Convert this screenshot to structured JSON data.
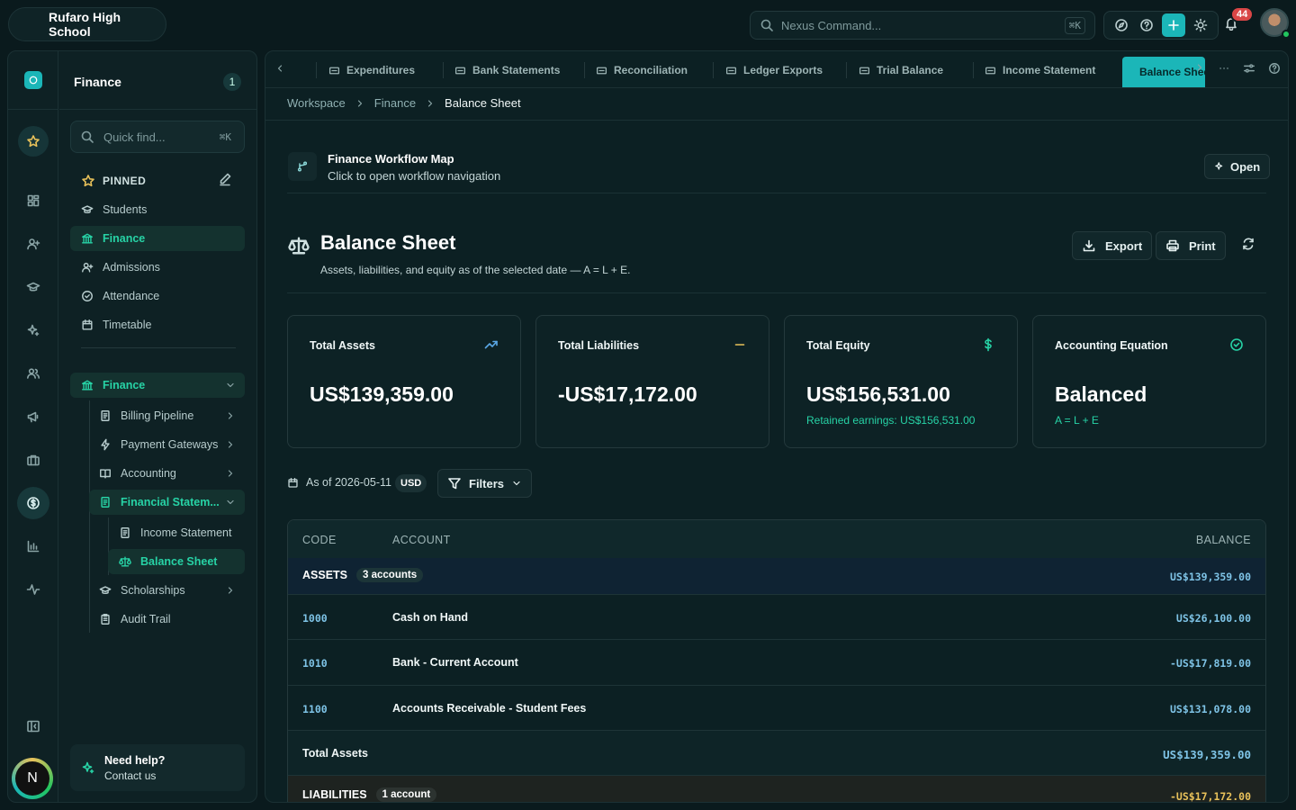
{
  "app": {
    "school_name": "Rufaro High School",
    "command_placeholder": "Nexus Command...",
    "command_shortcut": "⌘K",
    "notification_count": "44",
    "brand_color": "#1bb6b8"
  },
  "sidebar": {
    "section_title": "Finance",
    "section_count": "1",
    "quick_find_placeholder": "Quick find...",
    "quick_find_shortcut": "⌘K",
    "pinned_label": "PINNED",
    "pinned": [
      {
        "label": "Students",
        "icon": "graduation-cap-icon"
      },
      {
        "label": "Finance",
        "icon": "bank-icon"
      },
      {
        "label": "Admissions",
        "icon": "user-plus-icon"
      },
      {
        "label": "Attendance",
        "icon": "check-circle-icon"
      },
      {
        "label": "Timetable",
        "icon": "calendar-icon"
      }
    ],
    "tree": {
      "root": "Finance",
      "items": [
        {
          "label": "Billing Pipeline",
          "icon": "document-icon"
        },
        {
          "label": "Payment Gateways",
          "icon": "bolt-icon"
        },
        {
          "label": "Accounting",
          "icon": "book-icon"
        },
        {
          "label": "Financial Statem...",
          "icon": "document-icon"
        },
        {
          "label": "Income Statement",
          "icon": "document-icon"
        },
        {
          "label": "Balance Sheet",
          "icon": "scale-icon"
        },
        {
          "label": "Scholarships",
          "icon": "graduation-cap-icon"
        },
        {
          "label": "Audit Trail",
          "icon": "clipboard-icon"
        }
      ]
    },
    "help_title": "Need help?",
    "help_sub": "Contact us",
    "profile_initial": "N"
  },
  "tabs": [
    {
      "label": "Expenditures"
    },
    {
      "label": "Bank Statements"
    },
    {
      "label": "Reconciliation"
    },
    {
      "label": "Ledger Exports"
    },
    {
      "label": "Trial Balance"
    },
    {
      "label": "Income Statement"
    },
    {
      "label": "Balance Sheet"
    }
  ],
  "breadcrumb": [
    "Workspace",
    "Finance",
    "Balance Sheet"
  ],
  "workflow": {
    "title": "Finance Workflow Map",
    "subtitle": "Click to open workflow navigation",
    "open_label": "Open"
  },
  "page": {
    "title": "Balance Sheet",
    "subtitle": "Assets, liabilities, and equity as of the selected date — A = L + E.",
    "export_label": "Export",
    "print_label": "Print"
  },
  "cards": [
    {
      "label": "Total Assets",
      "value": "US$139,359.00",
      "sub": "",
      "icon": "trending-up-icon",
      "color": "#5aa8e6"
    },
    {
      "label": "Total Liabilities",
      "value": "-US$17,172.00",
      "sub": "",
      "icon": "minus-icon",
      "color": "#e8c15a"
    },
    {
      "label": "Total Equity",
      "value": "US$156,531.00",
      "sub": "Retained earnings: US$156,531.00",
      "icon": "dollar-icon",
      "color": "#27d3a6"
    },
    {
      "label": "Accounting Equation",
      "value": "Balanced",
      "sub": "A = L + E",
      "icon": "check-circle-icon",
      "color": "#27d3a6"
    }
  ],
  "filters": {
    "as_of": "As of 2026-05-11",
    "currency": "USD",
    "filters_label": "Filters"
  },
  "table": {
    "headers": {
      "code": "CODE",
      "account": "ACCOUNT",
      "balance": "BALANCE"
    },
    "assets_group": {
      "label": "ASSETS",
      "count": "3 accounts",
      "total": "US$139,359.00"
    },
    "rows": [
      {
        "code": "1000",
        "account": "Cash on Hand",
        "balance": "US$26,100.00"
      },
      {
        "code": "1010",
        "account": "Bank - Current Account",
        "balance": "-US$17,819.00"
      },
      {
        "code": "1100",
        "account": "Accounts Receivable - Student Fees",
        "balance": "US$131,078.00"
      }
    ],
    "total_assets_label": "Total Assets",
    "total_assets_value": "US$139,359.00",
    "liabilities_group": {
      "label": "LIABILITIES",
      "count": "1 account",
      "total": "-US$17,172.00"
    }
  }
}
